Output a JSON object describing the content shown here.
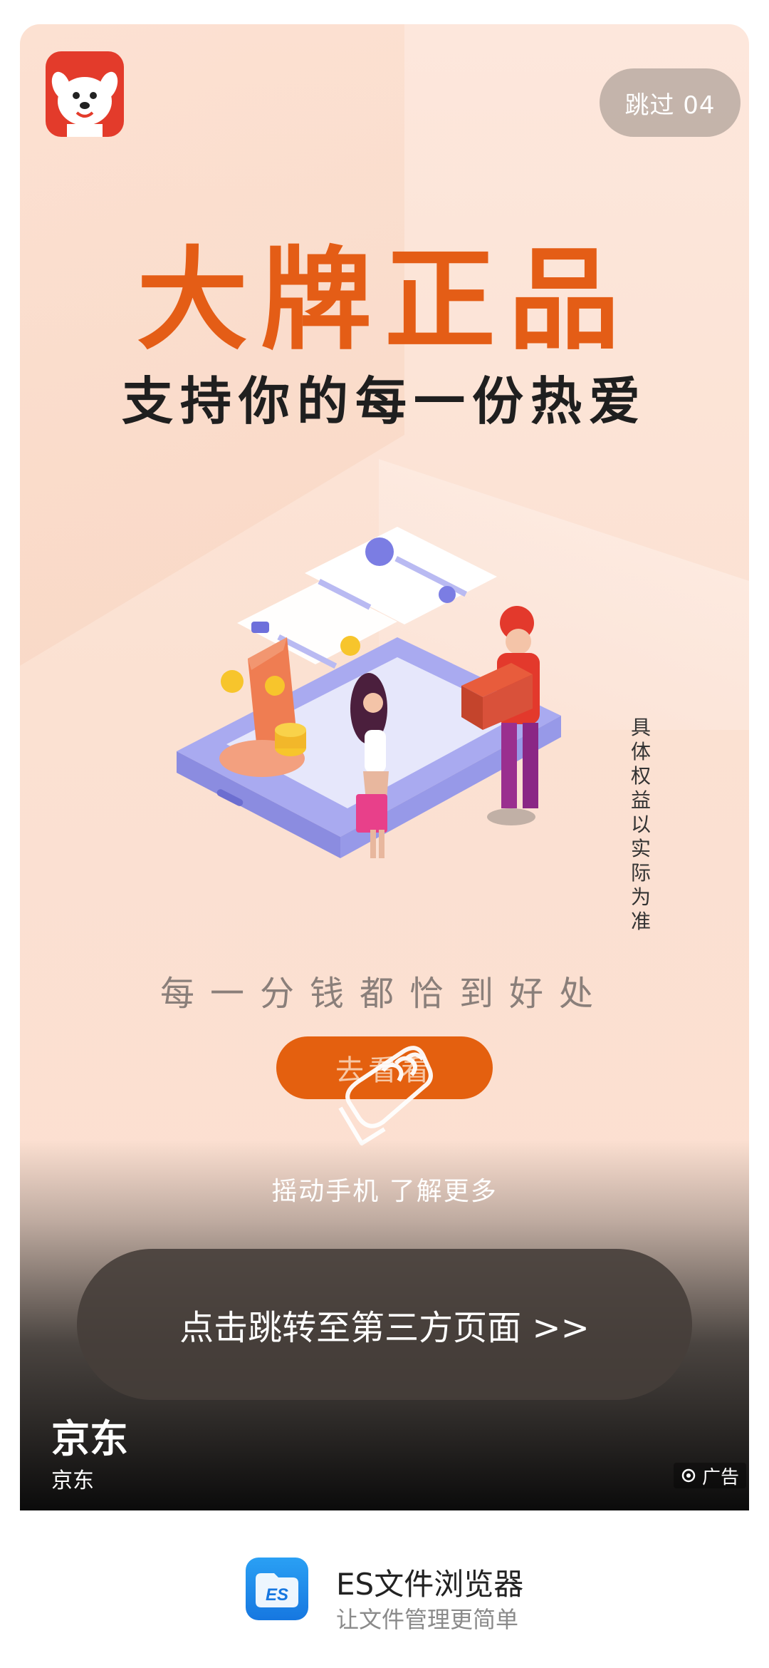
{
  "skip": {
    "label": "跳过 04"
  },
  "ad": {
    "headline": "大牌正品",
    "subheadline": "支持你的每一份热爱",
    "side_note": "具体权益以实际为准",
    "tagline": "每一分钱都恰到好处",
    "cta_label": "去看看",
    "shake_prompt": "摇动手机  了解更多",
    "jump_label": "点击跳转至第三方页面  >>",
    "advertiser_title": "京东",
    "advertiser_subtitle": "京东",
    "ad_badge": "广告"
  },
  "footer": {
    "app_name": "ES文件浏览器",
    "app_tagline": "让文件管理更简单"
  },
  "colors": {
    "accent": "#e45d16",
    "cta": "#e4600f",
    "logo_red": "#e33b2b",
    "es_blue": "#1677e0"
  },
  "icons": [
    "jd-dog-logo-icon",
    "shake-hand-icon",
    "ad-target-icon",
    "es-file-explorer-icon"
  ]
}
